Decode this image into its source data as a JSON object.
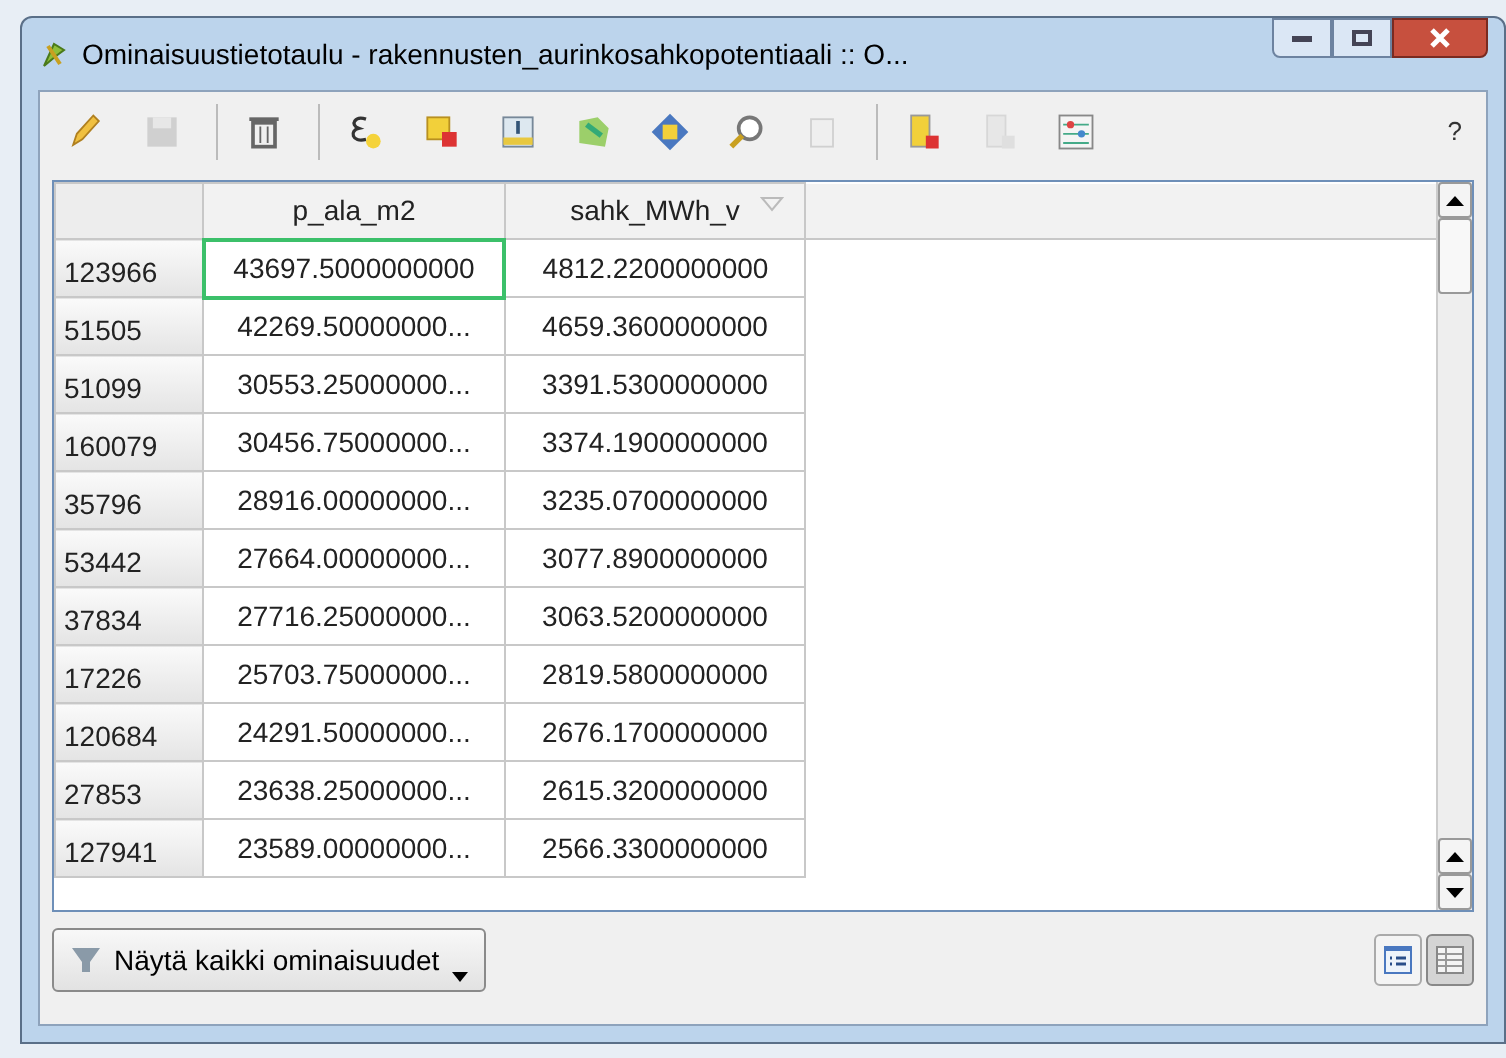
{
  "window": {
    "title": "Ominaisuustietotaulu - rakennusten_aurinkosahkopotentiaali :: O..."
  },
  "toolbar": {
    "groups": [
      [
        {
          "kind": "pencil",
          "disabled": false
        },
        {
          "kind": "save",
          "disabled": true
        }
      ],
      [
        {
          "kind": "trash",
          "disabled": false
        }
      ],
      [
        {
          "kind": "expression",
          "disabled": false
        },
        {
          "kind": "deselect",
          "disabled": false
        },
        {
          "kind": "move-top",
          "disabled": false
        },
        {
          "kind": "invert",
          "disabled": false
        },
        {
          "kind": "pan",
          "disabled": false
        },
        {
          "kind": "zoom",
          "disabled": false
        },
        {
          "kind": "paste",
          "disabled": true
        }
      ],
      [
        {
          "kind": "delete-column",
          "disabled": false
        },
        {
          "kind": "add-column",
          "disabled": true
        },
        {
          "kind": "calculator",
          "disabled": false
        }
      ]
    ],
    "help": "?"
  },
  "table": {
    "columns": [
      {
        "label": "p_ala_m2",
        "sorted": false
      },
      {
        "label": "sahk_MWh_v",
        "sorted": true
      }
    ],
    "rows": [
      {
        "id": "123966",
        "cells": [
          {
            "text": "43697.5000000000",
            "selected": true
          },
          {
            "text": "4812.2200000000",
            "selected": false
          }
        ]
      },
      {
        "id": "51505",
        "cells": [
          {
            "text": "42269.50000000...",
            "selected": false
          },
          {
            "text": "4659.3600000000",
            "selected": false
          }
        ]
      },
      {
        "id": "51099",
        "cells": [
          {
            "text": "30553.25000000...",
            "selected": false
          },
          {
            "text": "3391.5300000000",
            "selected": false
          }
        ]
      },
      {
        "id": "160079",
        "cells": [
          {
            "text": "30456.75000000...",
            "selected": false
          },
          {
            "text": "3374.1900000000",
            "selected": false
          }
        ]
      },
      {
        "id": "35796",
        "cells": [
          {
            "text": "28916.00000000...",
            "selected": false
          },
          {
            "text": "3235.0700000000",
            "selected": false
          }
        ]
      },
      {
        "id": "53442",
        "cells": [
          {
            "text": "27664.00000000...",
            "selected": false
          },
          {
            "text": "3077.8900000000",
            "selected": false
          }
        ]
      },
      {
        "id": "37834",
        "cells": [
          {
            "text": "27716.25000000...",
            "selected": false
          },
          {
            "text": "3063.5200000000",
            "selected": false
          }
        ]
      },
      {
        "id": "17226",
        "cells": [
          {
            "text": "25703.75000000...",
            "selected": false
          },
          {
            "text": "2819.5800000000",
            "selected": false
          }
        ]
      },
      {
        "id": "120684",
        "cells": [
          {
            "text": "24291.50000000...",
            "selected": false
          },
          {
            "text": "2676.1700000000",
            "selected": false
          }
        ]
      },
      {
        "id": "27853",
        "cells": [
          {
            "text": "23638.25000000...",
            "selected": false
          },
          {
            "text": "2615.3200000000",
            "selected": false
          }
        ]
      },
      {
        "id": "127941",
        "cells": [
          {
            "text": "23589.00000000...",
            "selected": false
          },
          {
            "text": "2566.3300000000",
            "selected": false
          }
        ]
      }
    ]
  },
  "footer": {
    "filter_button": "Näytä kaikki ominaisuudet",
    "views": [
      {
        "kind": "form",
        "selected": false
      },
      {
        "kind": "table",
        "selected": true
      }
    ]
  }
}
